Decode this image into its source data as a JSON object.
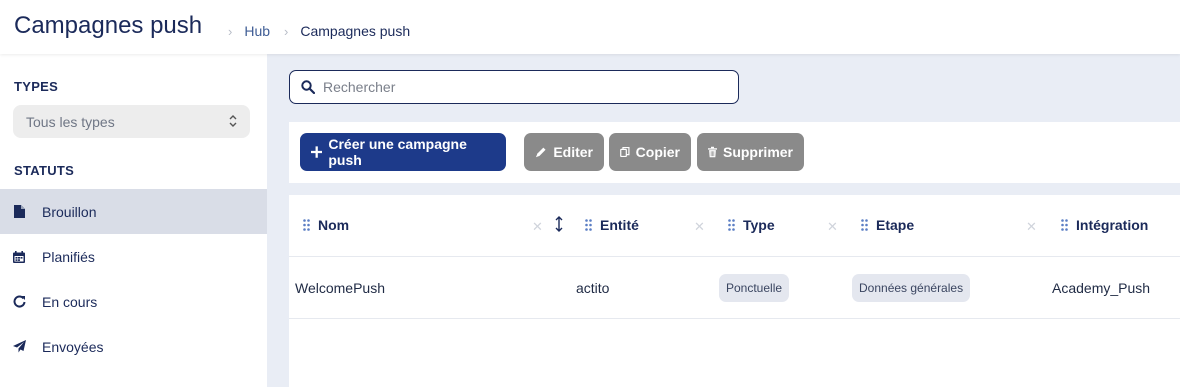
{
  "header": {
    "title": "Campagnes push",
    "breadcrumb": [
      "Hub",
      "Campagnes push"
    ]
  },
  "sidebar": {
    "types_title": "TYPES",
    "types_select_value": "Tous les types",
    "statuts_title": "STATUTS",
    "statuses": [
      {
        "label": "Brouillon",
        "icon": "file-icon",
        "active": true
      },
      {
        "label": "Planifiés",
        "icon": "calendar-icon",
        "active": false
      },
      {
        "label": "En cours",
        "icon": "refresh-icon",
        "active": false
      },
      {
        "label": "Envoyées",
        "icon": "send-icon",
        "active": false
      }
    ]
  },
  "search": {
    "placeholder": "Rechercher",
    "value": ""
  },
  "toolbar": {
    "create_label": "Créer une campagne push",
    "edit_label": "Editer",
    "copy_label": "Copier",
    "delete_label": "Supprimer"
  },
  "table": {
    "columns": [
      "Nom",
      "Entité",
      "Type",
      "Etape",
      "Intégration"
    ],
    "rows": [
      {
        "nom": "WelcomePush",
        "entite": "actito",
        "type": "Ponctuelle",
        "etape": "Données générales",
        "integration": "Academy_Push"
      }
    ]
  },
  "colors": {
    "primary": "#1d3a8a",
    "title": "#1b2a5a",
    "main_bg": "#e9edf5",
    "active_item": "#d9dde7",
    "disabled_btn": "#8a8a8a"
  }
}
